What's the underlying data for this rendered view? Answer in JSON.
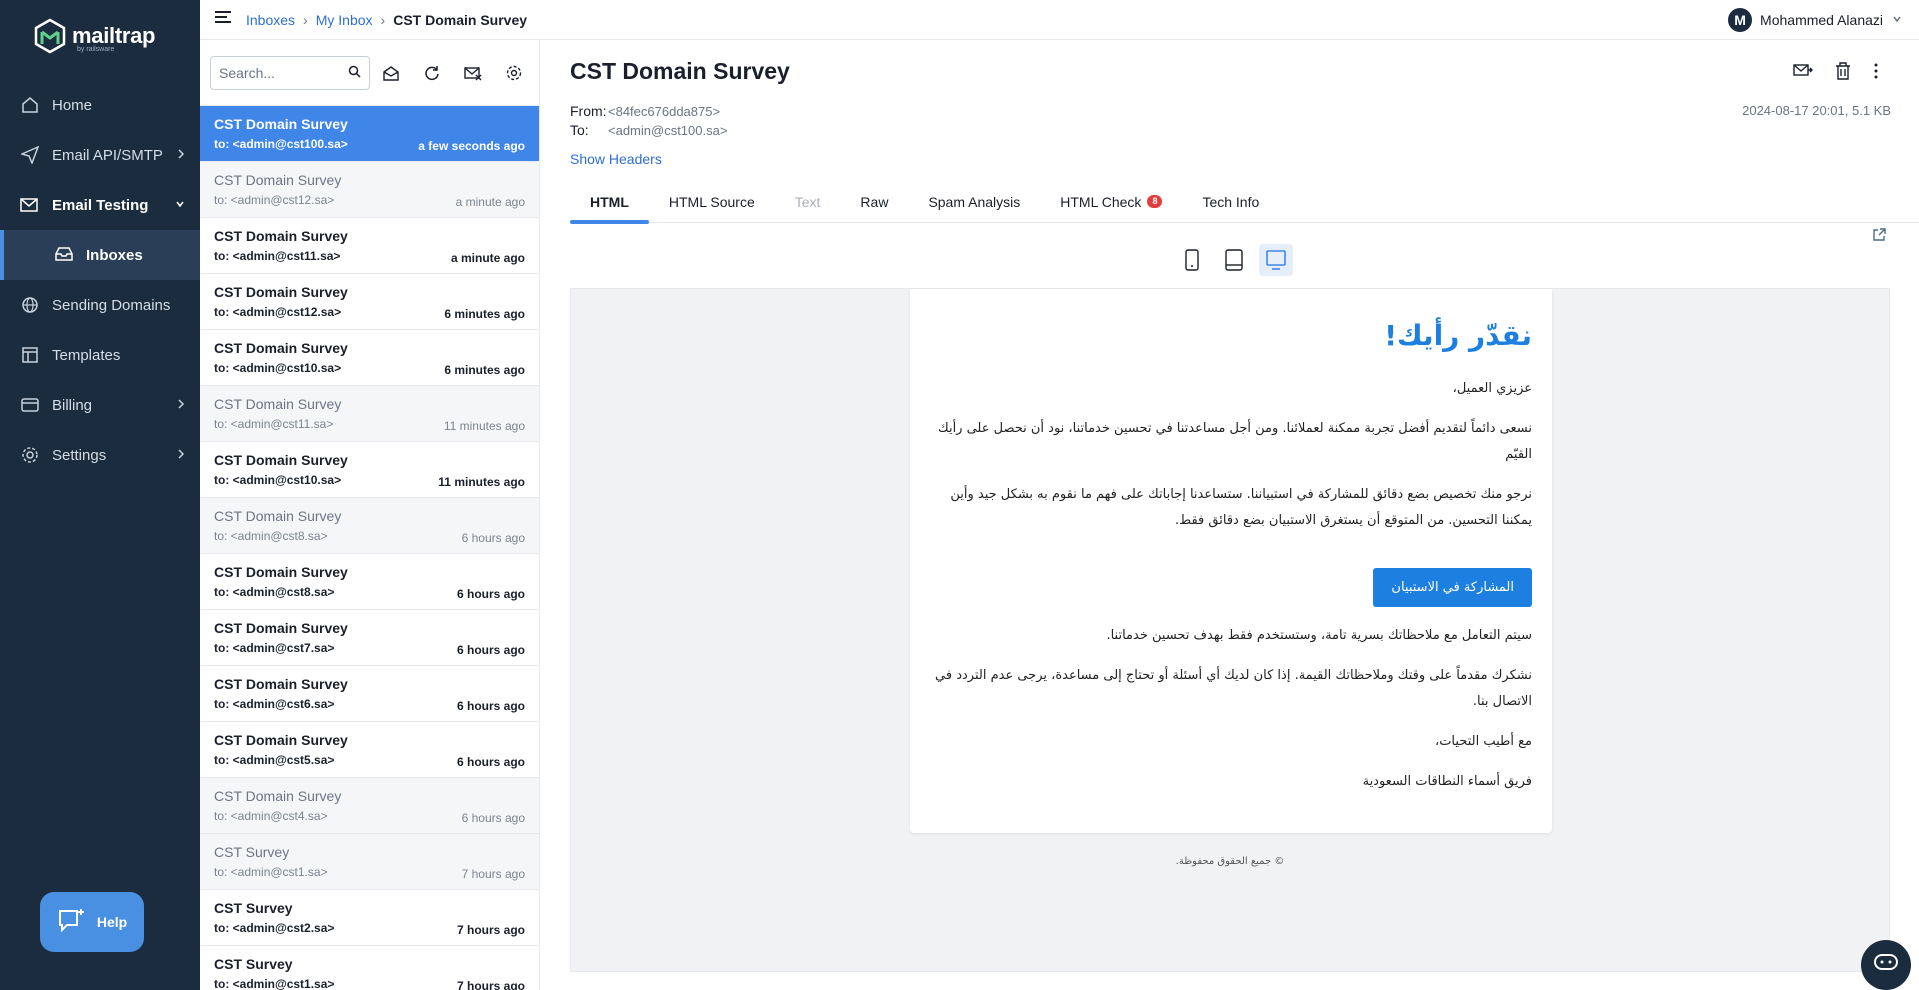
{
  "brand": {
    "name": "mailtrap",
    "sub": "by railsware"
  },
  "sidebar": {
    "items": [
      {
        "label": "Home",
        "icon": "home-icon"
      },
      {
        "label": "Email API/SMTP",
        "icon": "send-icon"
      },
      {
        "label": "Email Testing",
        "icon": "testing-icon"
      },
      {
        "label": "Inboxes",
        "icon": "inbox-icon"
      },
      {
        "label": "Sending Domains",
        "icon": "globe-icon"
      },
      {
        "label": "Templates",
        "icon": "templates-icon"
      },
      {
        "label": "Billing",
        "icon": "billing-icon"
      },
      {
        "label": "Settings",
        "icon": "gear-icon"
      }
    ],
    "help_label": "Help"
  },
  "topbar": {
    "crumb1": "Inboxes",
    "crumb2": "My Inbox",
    "crumb3": "CST Domain Survey",
    "sep": "›",
    "user_initial": "M",
    "user_name": "Mohammed Alanazi"
  },
  "search": {
    "placeholder": "Search..."
  },
  "messages": [
    {
      "subject": "CST Domain Survey",
      "to": "to: <admin@cst100.sa>",
      "time": "a few seconds ago"
    },
    {
      "subject": "CST Domain Survey",
      "to": "to: <admin@cst12.sa>",
      "time": "a minute ago"
    },
    {
      "subject": "CST Domain Survey",
      "to": "to: <admin@cst11.sa>",
      "time": "a minute ago"
    },
    {
      "subject": "CST Domain Survey",
      "to": "to: <admin@cst12.sa>",
      "time": "6 minutes ago"
    },
    {
      "subject": "CST Domain Survey",
      "to": "to: <admin@cst10.sa>",
      "time": "6 minutes ago"
    },
    {
      "subject": "CST Domain Survey",
      "to": "to: <admin@cst11.sa>",
      "time": "11 minutes ago"
    },
    {
      "subject": "CST Domain Survey",
      "to": "to: <admin@cst10.sa>",
      "time": "11 minutes ago"
    },
    {
      "subject": "CST Domain Survey",
      "to": "to: <admin@cst8.sa>",
      "time": "6 hours ago"
    },
    {
      "subject": "CST Domain Survey",
      "to": "to: <admin@cst8.sa>",
      "time": "6 hours ago"
    },
    {
      "subject": "CST Domain Survey",
      "to": "to: <admin@cst7.sa>",
      "time": "6 hours ago"
    },
    {
      "subject": "CST Domain Survey",
      "to": "to: <admin@cst6.sa>",
      "time": "6 hours ago"
    },
    {
      "subject": "CST Domain Survey",
      "to": "to: <admin@cst5.sa>",
      "time": "6 hours ago"
    },
    {
      "subject": "CST Domain Survey",
      "to": "to: <admin@cst4.sa>",
      "time": "6 hours ago"
    },
    {
      "subject": "CST Survey",
      "to": "to: <admin@cst1.sa>",
      "time": "7 hours ago"
    },
    {
      "subject": "CST Survey",
      "to": "to: <admin@cst2.sa>",
      "time": "7 hours ago"
    },
    {
      "subject": "CST Survey",
      "to": "to: <admin@cst1.sa>",
      "time": "7 hours ago"
    }
  ],
  "detail": {
    "title": "CST Domain Survey",
    "from_label": "From:",
    "from_value": "<84fec676dda875>",
    "to_label": "To:",
    "to_value": "<admin@cst100.sa>",
    "date_size": "2024-08-17 20:01, 5.1 KB",
    "show_headers": "Show Headers",
    "tabs": [
      "HTML",
      "HTML Source",
      "Text",
      "Raw",
      "Spam Analysis",
      "HTML Check",
      "Tech Info"
    ],
    "html_check_count": "8"
  },
  "email": {
    "heading": "نقدّر رأيك!",
    "greeting": "عزيزي العميل،",
    "p1": "نسعى دائماً لتقديم أفضل تجربة ممكنة لعملائنا. ومن أجل مساعدتنا في تحسين خدماتنا، نود أن نحصل على رأيك القيّم",
    "p2": "نرجو منك تخصيص بضع دقائق للمشاركة في استبياننا. ستساعدنا إجاباتك على فهم ما نقوم به بشكل جيد وأين يمكننا التحسين. من المتوقع أن يستغرق الاستبيان بضع دقائق فقط.",
    "button": "المشاركة في الاستبيان",
    "p3": "سيتم التعامل مع ملاحظاتك بسرية تامة، وستستخدم فقط بهدف تحسين خدماتنا.",
    "p4": "نشكرك مقدماً على وقتك وملاحظاتك القيمة. إذا كان لديك أي أسئلة أو تحتاج إلى مساعدة، يرجى عدم التردد في الاتصال بنا.",
    "p5": "مع أطيب التحيات،",
    "p6": "فريق أسماء النطاقات السعودية",
    "footer": "© جميع الحقوق محفوظة."
  },
  "colors": {
    "sidebar_bg": "#1b2c3f",
    "accent": "#3f86e8",
    "email_blue": "#1d7fe0",
    "badge": "#e43d3d"
  }
}
